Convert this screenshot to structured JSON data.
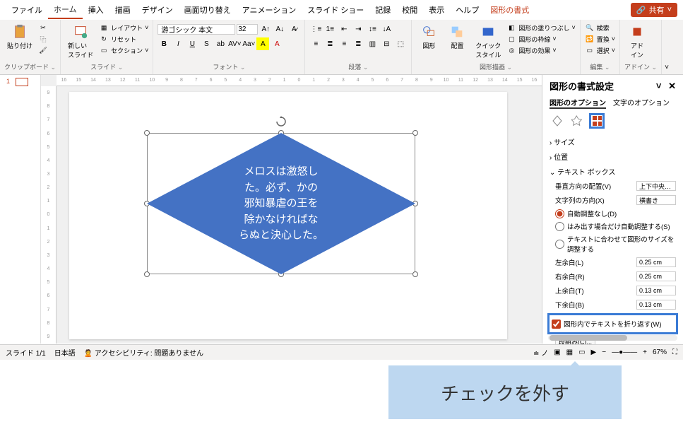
{
  "menu": {
    "tabs": [
      "ファイル",
      "ホーム",
      "挿入",
      "描画",
      "デザイン",
      "画面切り替え",
      "アニメーション",
      "スライド ショー",
      "記録",
      "校閲",
      "表示",
      "ヘルプ"
    ],
    "context_tab": "図形の書式",
    "share": "共有"
  },
  "ribbon": {
    "clipboard": {
      "paste": "貼り付け",
      "label": "クリップボード"
    },
    "slides": {
      "new": "新しい\nスライド",
      "layout": "レイアウト",
      "reset": "リセット",
      "section": "セクション",
      "label": "スライド"
    },
    "font": {
      "name": "游ゴシック 本文",
      "size": "32",
      "label": "フォント"
    },
    "paragraph": {
      "label": "段落"
    },
    "drawing": {
      "shapes": "図形",
      "arrange": "配置",
      "quick": "クイック\nスタイル",
      "fill": "図形の塗りつぶし",
      "outline": "図形の枠線",
      "effects": "図形の効果",
      "label": "図形描画"
    },
    "editing": {
      "find": "検索",
      "replace": "置換",
      "select": "選択",
      "label": "編集"
    },
    "addin": {
      "btn": "アド\nイン",
      "label": "アドイン"
    }
  },
  "ruler": {
    "h": [
      "16",
      "15",
      "14",
      "13",
      "12",
      "11",
      "10",
      "9",
      "8",
      "7",
      "6",
      "5",
      "4",
      "3",
      "2",
      "1",
      "0",
      "1",
      "2",
      "3",
      "4",
      "5",
      "6",
      "7",
      "8",
      "9",
      "10",
      "11",
      "12",
      "13",
      "14",
      "15",
      "16"
    ],
    "v": [
      "9",
      "8",
      "7",
      "6",
      "5",
      "4",
      "3",
      "2",
      "1",
      "0",
      "1",
      "2",
      "3",
      "4",
      "5",
      "6",
      "7",
      "8",
      "9"
    ]
  },
  "thumb": {
    "num": "1"
  },
  "shape_text": "メロスは激怒し\nた。必ず、かの\n邪知暴虐の王を\n除かなければな\nらぬと決心した。",
  "pane": {
    "title": "図形の書式設定",
    "tab1": "図形のオプション",
    "tab2": "文字のオプション",
    "size": "サイズ",
    "position": "位置",
    "textbox": "テキスト ボックス",
    "valign_label": "垂直方向の配置(V)",
    "valign_val": "上下中央…",
    "textdir_label": "文字列の方向(X)",
    "textdir_val": "横書き",
    "autofit_none": "自動調整なし(D)",
    "autofit_shrink": "はみ出す場合だけ自動調整する(S)",
    "autofit_resize": "テキストに合わせて図形のサイズを調整する",
    "margin_l_label": "左余白(L)",
    "margin_l": "0.25 cm",
    "margin_r_label": "右余白(R)",
    "margin_r": "0.25 cm",
    "margin_t_label": "上余白(T)",
    "margin_t": "0.13 cm",
    "margin_b_label": "下余白(B)",
    "margin_b": "0.13 cm",
    "wrap": "図形内でテキストを折り返す(W)",
    "columns": "段組み(C)..."
  },
  "status": {
    "slide": "スライド 1/1",
    "lang": "日本語",
    "access": "アクセシビリティ: 問題ありません",
    "notes": "ノ",
    "zoom": "67%"
  },
  "callout": "チェックを外す"
}
